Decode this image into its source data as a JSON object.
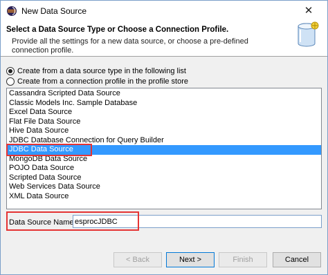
{
  "window": {
    "title": "New Data Source",
    "close_glyph": "✕"
  },
  "header": {
    "title": "Select a Data Source Type or Choose a Connection Profile.",
    "description": "Provide all the settings for a new data source, or choose a pre-defined connection profile."
  },
  "options": {
    "from_type": {
      "label": "Create from a data source type in the following list",
      "checked": true
    },
    "from_profile": {
      "label": "Create from a connection profile in the profile store",
      "checked": false
    }
  },
  "list": {
    "items": [
      "Cassandra Scripted Data Source",
      "Classic Models Inc. Sample Database",
      "Excel Data Source",
      "Flat File Data Source",
      "Hive Data Source",
      "JDBC Database Connection for Query Builder",
      "JDBC Data Source",
      "MongoDB Data Source",
      "POJO Data Source",
      "Scripted Data Source",
      "Web Services Data Source",
      "XML Data Source"
    ],
    "selected_item": "JDBC Data Source"
  },
  "name_field": {
    "label": "Data Source Name:",
    "value": "esprocJDBC"
  },
  "buttons": {
    "back": "< Back",
    "next": "Next >",
    "finish": "Finish",
    "cancel": "Cancel"
  },
  "colors": {
    "selection": "#3399ff",
    "highlight": "#e53333"
  }
}
